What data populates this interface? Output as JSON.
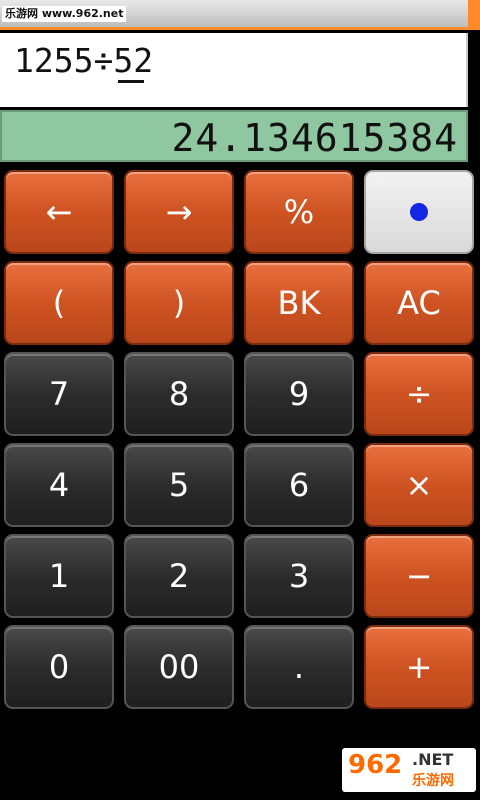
{
  "watermark_top": "乐游网 www.962.net",
  "expression": "1255÷52",
  "result": "24.134615384",
  "keys": {
    "left": "←",
    "right": "→",
    "percent": "%",
    "paren_open": "(",
    "paren_close": ")",
    "backspace": "BK",
    "clear": "AC",
    "seven": "7",
    "eight": "8",
    "nine": "9",
    "divide": "÷",
    "four": "4",
    "five": "5",
    "six": "6",
    "multiply": "×",
    "one": "1",
    "two": "2",
    "three": "3",
    "minus": "−",
    "zero": "0",
    "double_zero": "00",
    "decimal": ".",
    "plus": "+"
  },
  "watermark_bottom": {
    "number": "962",
    "suffix": ".NET",
    "chinese": "乐游网"
  },
  "colors": {
    "orange_key": "#cf5322",
    "dark_key": "#2c2c2c",
    "light_key": "#e4e4e4",
    "lcd": "#8fc8a0",
    "accent": "#ff8a2a",
    "dot": "#1326e0"
  }
}
